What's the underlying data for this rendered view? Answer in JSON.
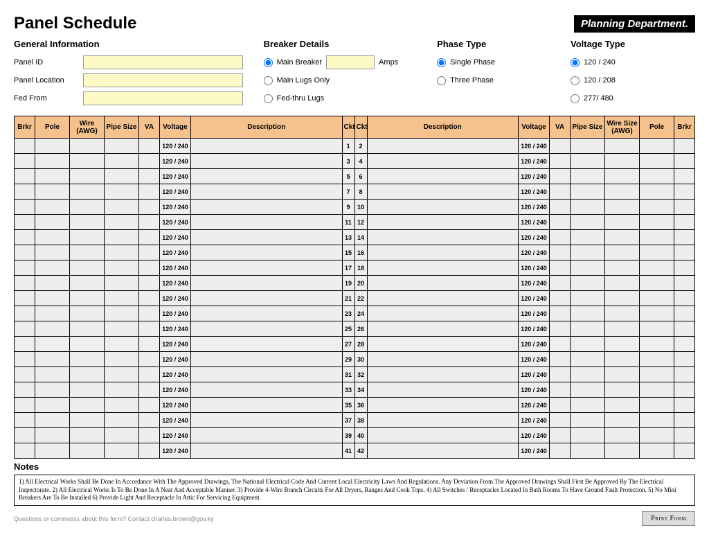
{
  "header": {
    "title": "Panel Schedule",
    "logo": "Planning Department."
  },
  "general": {
    "title": "General Information",
    "panel_id_label": "Panel ID",
    "panel_location_label": "Panel Location",
    "fed_from_label": "Fed From"
  },
  "breaker": {
    "title": "Breaker Details",
    "main_breaker": "Main Breaker",
    "amps": "Amps",
    "main_lugs": "Main Lugs Only",
    "fed_thru": "Fed-thru Lugs"
  },
  "phase": {
    "title": "Phase Type",
    "single": "Single Phase",
    "three": "Three Phase"
  },
  "voltage": {
    "title": "Voltage Type",
    "v120_240": "120 / 240",
    "v120_208": "120 / 208",
    "v277_480": "277/ 480"
  },
  "columns": {
    "brkr": "Brkr",
    "pole": "Pole",
    "wire": "Wire (AWG)",
    "pipe": "Pipe Size",
    "va": "VA",
    "voltage": "Voltage",
    "description": "Description",
    "ckt": "Ckt",
    "wire_size": "Wire Size (AWG)",
    "pipe_size": "Pipe Size"
  },
  "row_voltage": "120 / 240",
  "ckt_pairs": [
    [
      1,
      2
    ],
    [
      3,
      4
    ],
    [
      5,
      6
    ],
    [
      7,
      8
    ],
    [
      9,
      10
    ],
    [
      11,
      12
    ],
    [
      13,
      14
    ],
    [
      15,
      16
    ],
    [
      17,
      18
    ],
    [
      19,
      20
    ],
    [
      21,
      22
    ],
    [
      23,
      24
    ],
    [
      25,
      26
    ],
    [
      27,
      28
    ],
    [
      29,
      30
    ],
    [
      31,
      32
    ],
    [
      33,
      34
    ],
    [
      35,
      36
    ],
    [
      37,
      38
    ],
    [
      39,
      40
    ],
    [
      41,
      42
    ]
  ],
  "notes": {
    "title": "Notes",
    "body": "1) All Electrical Works Shall Be Done In Accordance With The Approved Drawings, The National Electrical Code And Current Local Electricity Laws And Regulations. Any Deviation From The Approved Drawings Shall First Be Approved By The Electrical Inspectorate. 2) All Electrical Works Is To Be Done In A Neat And Acceptable Manner. 3) Provide 4-Wire Branch Circuits For All Dryers, Ranges And Cook Tops. 4) All Switches / Receptacles Located In Bath Rooms To Have Ground Fault Protection.  5) No Mini Breakers Are To Be Installed  6) Provide Light And Receptacle In Attic For Servicing Equipment."
  },
  "footer": {
    "contact": "Questions or comments about this form? Contact charles.brown@gov.ky",
    "print": "Print Form"
  }
}
